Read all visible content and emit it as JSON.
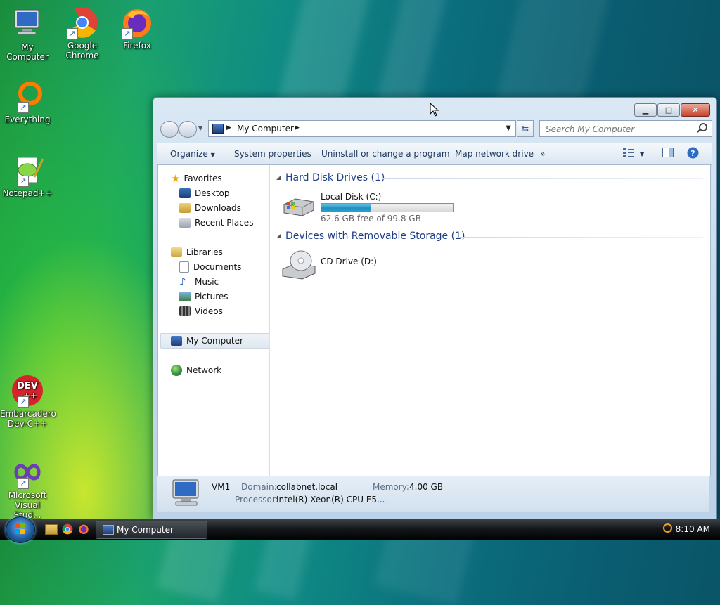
{
  "desktop": {
    "icons": [
      {
        "label": "My Computer"
      },
      {
        "label": "Google Chrome"
      },
      {
        "label": "Firefox"
      },
      {
        "label": "Everything"
      },
      {
        "label": "Notepad++"
      },
      {
        "label": "Embarcadero Dev-C++"
      },
      {
        "label": "Microsoft Visual Stud..."
      }
    ]
  },
  "window": {
    "address": {
      "location": "My Computer"
    },
    "search": {
      "placeholder": "Search My Computer"
    },
    "toolbar": {
      "organize": "Organize",
      "system_properties": "System properties",
      "uninstall": "Uninstall or change a program",
      "map_drive": "Map network drive",
      "more": "»"
    },
    "nav_pane": {
      "favorites": "Favorites",
      "desktop": "Desktop",
      "downloads": "Downloads",
      "recent_places": "Recent Places",
      "libraries": "Libraries",
      "documents": "Documents",
      "music": "Music",
      "pictures": "Pictures",
      "videos": "Videos",
      "my_computer": "My Computer",
      "network": "Network"
    },
    "groups": {
      "hard_disk_header": "Hard Disk Drives (1)",
      "removable_header": "Devices with Removable Storage (1)"
    },
    "drives": {
      "local_disk_name": "Local Disk (C:)",
      "local_disk_free": "62.6 GB free of 99.8 GB",
      "local_disk_used_fraction": 0.373,
      "cd_drive_name": "CD Drive (D:)"
    },
    "details": {
      "computer_name": "VM1",
      "domain_label": "Domain:",
      "domain_value": "collabnet.local",
      "memory_label": "Memory:",
      "memory_value": "4.00 GB",
      "processor_label": "Processor:",
      "processor_value": "Intel(R) Xeon(R) CPU E5..."
    }
  },
  "taskbar": {
    "active_window": "My Computer",
    "clock": "8:10 AM"
  },
  "colors": {
    "accent": "#1e3f88",
    "progress_fill": "#1f8fbf"
  }
}
